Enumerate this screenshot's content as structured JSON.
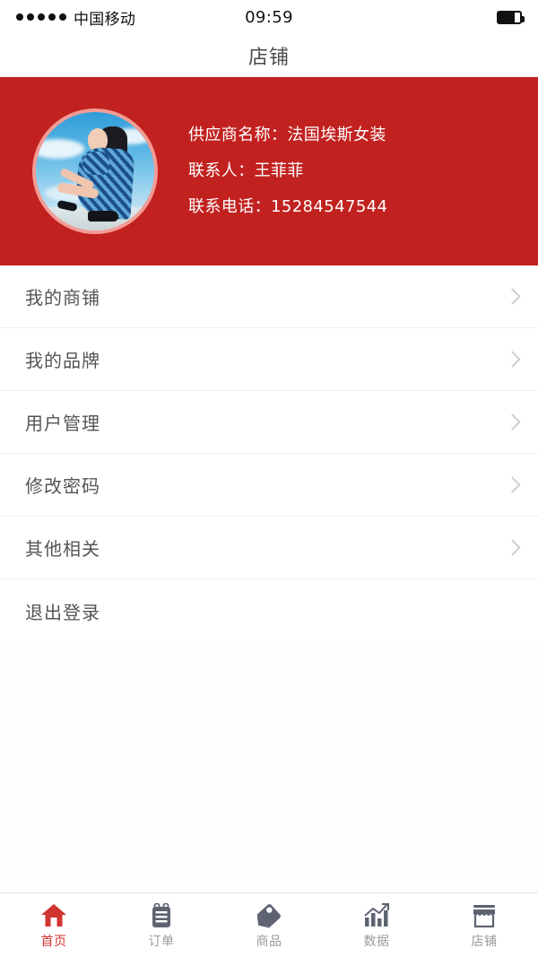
{
  "statusbar": {
    "signal_dots": 5,
    "carrier": "中国移动",
    "time": "09:59",
    "battery_icon": "battery-icon",
    "battery_level": "76%"
  },
  "navbar": {
    "title": "店铺"
  },
  "profile": {
    "background_color": "#c1211f",
    "avatar": {
      "icon": "avatar-photo",
      "alt": "woman in blue polka dot dress against blue sky",
      "ring_color": "#f39b95"
    },
    "lines": [
      "供应商名称：法国埃斯女装",
      "联系人：王菲菲",
      "联系电话：15284547544"
    ],
    "supplier_name_label": "供应商名称：",
    "supplier_name_value": "法国埃斯女装",
    "contact_label": "联系人：",
    "contact_value": "王菲菲",
    "phone_label": "联系电话：",
    "phone_value": "15284547544"
  },
  "menu": {
    "items": [
      {
        "label": "我的商铺",
        "chevron": true
      },
      {
        "label": "我的品牌",
        "chevron": true
      },
      {
        "label": "用户管理",
        "chevron": true
      },
      {
        "label": "修改密码",
        "chevron": true
      },
      {
        "label": "其他相关",
        "chevron": true
      },
      {
        "label": "退出登录",
        "chevron": false
      }
    ]
  },
  "tabbar": {
    "active_color": "#d0342f",
    "inactive_color": "#9a9a9a",
    "tabs": [
      {
        "label": "首页",
        "icon": "home-icon",
        "active": true
      },
      {
        "label": "订单",
        "icon": "clipboard-icon",
        "active": false
      },
      {
        "label": "商品",
        "icon": "tag-icon",
        "active": false
      },
      {
        "label": "数据",
        "icon": "chart-icon",
        "active": false
      },
      {
        "label": "店铺",
        "icon": "store-icon",
        "active": false
      }
    ]
  }
}
